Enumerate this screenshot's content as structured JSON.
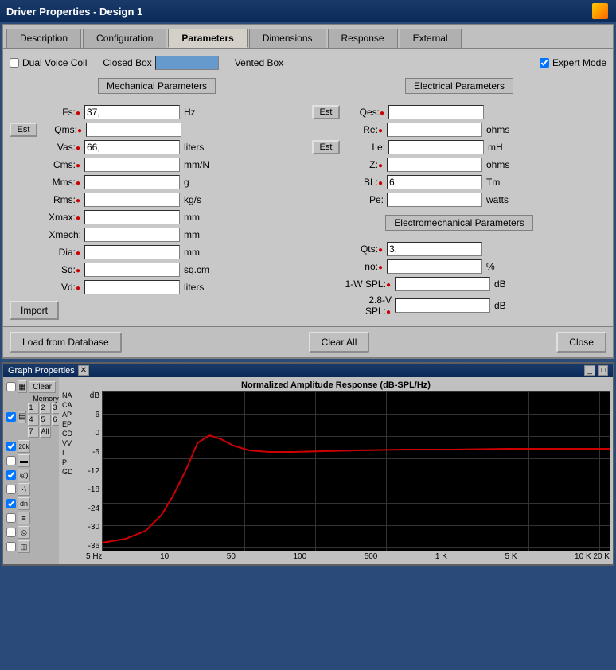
{
  "titlebar": {
    "title": "Driver Properties - Design 1"
  },
  "tabs": [
    {
      "id": "description",
      "label": "Description",
      "active": false
    },
    {
      "id": "configuration",
      "label": "Configuration",
      "active": false
    },
    {
      "id": "parameters",
      "label": "Parameters",
      "active": true
    },
    {
      "id": "dimensions",
      "label": "Dimensions",
      "active": false
    },
    {
      "id": "response",
      "label": "Response",
      "active": false
    },
    {
      "id": "external",
      "label": "External",
      "active": false
    }
  ],
  "options": {
    "dual_voice_coil_label": "Dual Voice Coil",
    "dual_voice_coil_checked": false,
    "closed_box_label": "Closed Box",
    "vented_box_label": "Vented Box",
    "expert_mode_label": "Expert Mode",
    "expert_mode_checked": true
  },
  "mechanical": {
    "header": "Mechanical Parameters",
    "params": [
      {
        "label": "Fs:",
        "value": "37,",
        "unit": "Hz",
        "has_est": false,
        "has_bullet": true
      },
      {
        "label": "Qms:",
        "value": "",
        "unit": "",
        "has_est": true,
        "has_bullet": true
      },
      {
        "label": "Vas:",
        "value": "66,",
        "unit": "liters",
        "has_est": false,
        "has_bullet": true
      },
      {
        "label": "Cms:",
        "value": "",
        "unit": "mm/N",
        "has_est": false,
        "has_bullet": true
      },
      {
        "label": "Mms:",
        "value": "",
        "unit": "g",
        "has_est": false,
        "has_bullet": true
      },
      {
        "label": "Rms:",
        "value": "",
        "unit": "kg/s",
        "has_est": false,
        "has_bullet": true
      },
      {
        "label": "Xmax:",
        "value": "",
        "unit": "mm",
        "has_est": false,
        "has_bullet": true
      },
      {
        "label": "Xmech:",
        "value": "",
        "unit": "mm",
        "has_est": false,
        "has_bullet": false
      },
      {
        "label": "Dia:",
        "value": "",
        "unit": "mm",
        "has_est": false,
        "has_bullet": true
      },
      {
        "label": "Sd:",
        "value": "",
        "unit": "sq.cm",
        "has_est": false,
        "has_bullet": true
      },
      {
        "label": "Vd:",
        "value": "",
        "unit": "liters",
        "has_est": false,
        "has_bullet": true
      }
    ]
  },
  "electrical": {
    "header": "Electrical Parameters",
    "params": [
      {
        "label": "Qes:",
        "value": "",
        "unit": "",
        "has_est": true,
        "has_bullet": true
      },
      {
        "label": "Re:",
        "value": "",
        "unit": "ohms",
        "has_est": false,
        "has_bullet": true
      },
      {
        "label": "Le:",
        "value": "",
        "unit": "mH",
        "has_est": true,
        "has_bullet": false
      },
      {
        "label": "Z:",
        "value": "",
        "unit": "ohms",
        "has_est": false,
        "has_bullet": true
      },
      {
        "label": "BL:",
        "value": "6,",
        "unit": "Tm",
        "has_est": false,
        "has_bullet": true
      },
      {
        "label": "Pe:",
        "value": "",
        "unit": "watts",
        "has_est": false,
        "has_bullet": false
      }
    ]
  },
  "electromechanical": {
    "header": "Electromechanical Parameters",
    "params": [
      {
        "label": "Qts:",
        "value": "3,",
        "unit": "",
        "has_bullet": true
      },
      {
        "label": "no:",
        "value": "",
        "unit": "%",
        "has_bullet": true
      },
      {
        "label": "1-W SPL:",
        "value": "",
        "unit": "dB",
        "has_bullet": true
      },
      {
        "label": "2.8-V SPL:",
        "value": "",
        "unit": "dB",
        "has_bullet": true
      }
    ]
  },
  "buttons": {
    "import": "Import",
    "load_from_database": "Load from Database",
    "clear_all": "Clear All",
    "close": "Close",
    "est": "Est"
  },
  "graph": {
    "title": "Graph Properties",
    "chart_title": "Normalized Amplitude Response (dB-SPL/Hz)",
    "y_labels": [
      "dB",
      "6",
      "0",
      "-6",
      "-12",
      "-18",
      "-24",
      "-30",
      "-36"
    ],
    "x_labels": [
      "5 Hz",
      "10",
      "50",
      "100",
      "500",
      "1K",
      "5K",
      "10K 20K"
    ],
    "category_labels": [
      "NA",
      "CA",
      "AP",
      "EP",
      "CD",
      "VV",
      "I",
      "P",
      "GD"
    ],
    "memory_label": "Memory",
    "memory_items": [
      "1",
      "2",
      "3",
      "4",
      "5",
      "6",
      "7",
      "All"
    ],
    "clear_label": "Clear",
    "legend_items": [
      {
        "checked": true,
        "icon": "▦",
        "label": ""
      },
      {
        "checked": false,
        "icon": "▤",
        "label": ""
      },
      {
        "checked": true,
        "icon": "20k",
        "label": ""
      },
      {
        "checked": false,
        "icon": "▬",
        "label": ""
      },
      {
        "checked": true,
        "icon": "((·)))",
        "label": ""
      },
      {
        "checked": false,
        "icon": "·)))",
        "label": ""
      },
      {
        "checked": true,
        "icon": "dn",
        "label": ""
      },
      {
        "checked": false,
        "icon": "≡",
        "label": ""
      },
      {
        "checked": false,
        "icon": "◎",
        "label": ""
      },
      {
        "checked": false,
        "icon": "◫",
        "label": ""
      }
    ]
  }
}
